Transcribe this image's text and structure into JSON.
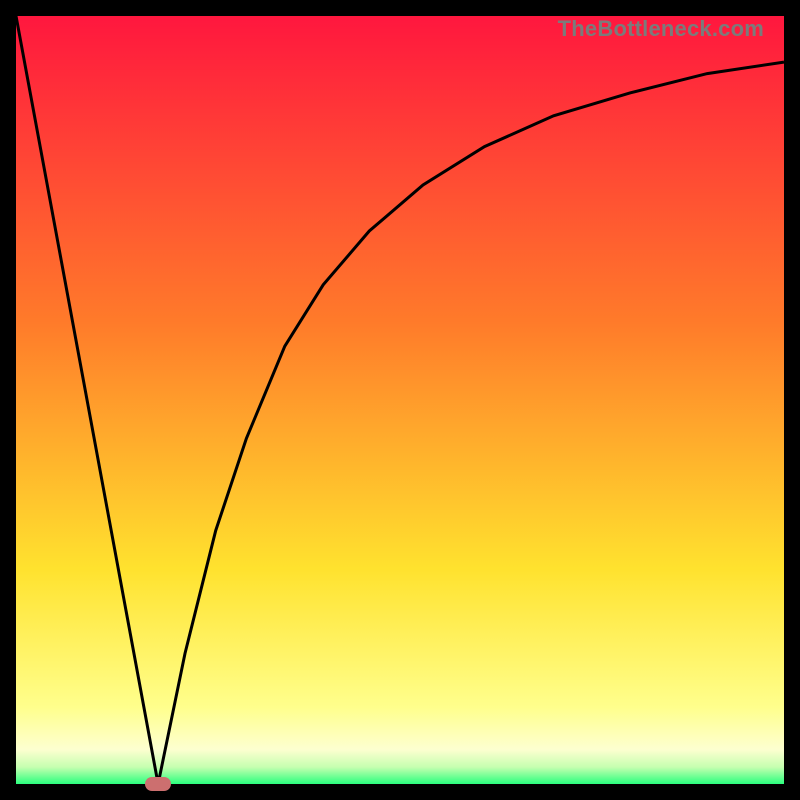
{
  "watermark": "TheBottleneck.com",
  "colors": {
    "top": "#ff173e",
    "mid1": "#ff7b2a",
    "mid2": "#ffe22e",
    "low": "#ffff8c",
    "band_pale": "#fdffd0",
    "band_green": "#2bff7e",
    "line": "#000000",
    "marker": "#cc6f6f",
    "frame": "#000000"
  },
  "chart_data": {
    "type": "line",
    "title": "",
    "xlabel": "",
    "ylabel": "",
    "xlim": [
      0,
      100
    ],
    "ylim": [
      0,
      100
    ],
    "annotations": [
      "TheBottleneck.com"
    ],
    "series": [
      {
        "name": "left-linear-drop",
        "x": [
          0,
          18.5
        ],
        "y": [
          100,
          0
        ]
      },
      {
        "name": "right-curve-rise",
        "x": [
          18.5,
          22,
          26,
          30,
          35,
          40,
          46,
          53,
          61,
          70,
          80,
          90,
          100
        ],
        "y": [
          0,
          17,
          33,
          45,
          57,
          65,
          72,
          78,
          83,
          87,
          90,
          92.5,
          94
        ]
      }
    ],
    "marker": {
      "x": 18.5,
      "y": 0
    },
    "gradient_stops": [
      {
        "pos": 0,
        "color": "#ff173e"
      },
      {
        "pos": 0.4,
        "color": "#ff7b2a"
      },
      {
        "pos": 0.72,
        "color": "#ffe22e"
      },
      {
        "pos": 0.9,
        "color": "#ffff8c"
      },
      {
        "pos": 0.955,
        "color": "#fdffd0"
      },
      {
        "pos": 0.978,
        "color": "#c6ffb0"
      },
      {
        "pos": 1.0,
        "color": "#2bff7e"
      }
    ]
  }
}
